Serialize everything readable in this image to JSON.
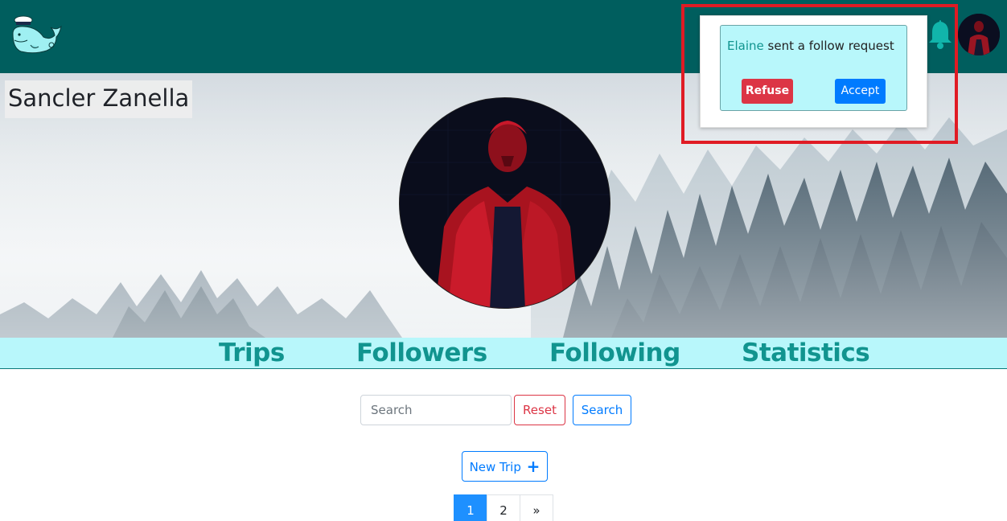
{
  "navbar": {
    "logo_icon": "whale-logo-icon",
    "bell_icon": "bell-icon",
    "avatar_icon": "user-avatar",
    "background": "#005e5e"
  },
  "profile": {
    "name": "Sancler Zanella"
  },
  "tabs": [
    {
      "label": "Trips"
    },
    {
      "label": "Followers"
    },
    {
      "label": "Following"
    },
    {
      "label": "Statistics"
    }
  ],
  "search": {
    "placeholder": "Search",
    "value": "",
    "reset_label": "Reset",
    "search_label": "Search"
  },
  "new_trip": {
    "label": "New Trip",
    "icon": "plus-icon"
  },
  "pagination": {
    "pages": [
      "1",
      "2"
    ],
    "next_label": "»",
    "active": "1"
  },
  "notification": {
    "name": "Elaine",
    "message": "sent a follow request",
    "refuse_label": "Refuse",
    "accept_label": "Accept"
  },
  "colors": {
    "teal": "#11948f",
    "tab_bg": "#b8f7fb",
    "danger": "#dc3545",
    "primary": "#007bff",
    "highlight": "#e01b24"
  }
}
